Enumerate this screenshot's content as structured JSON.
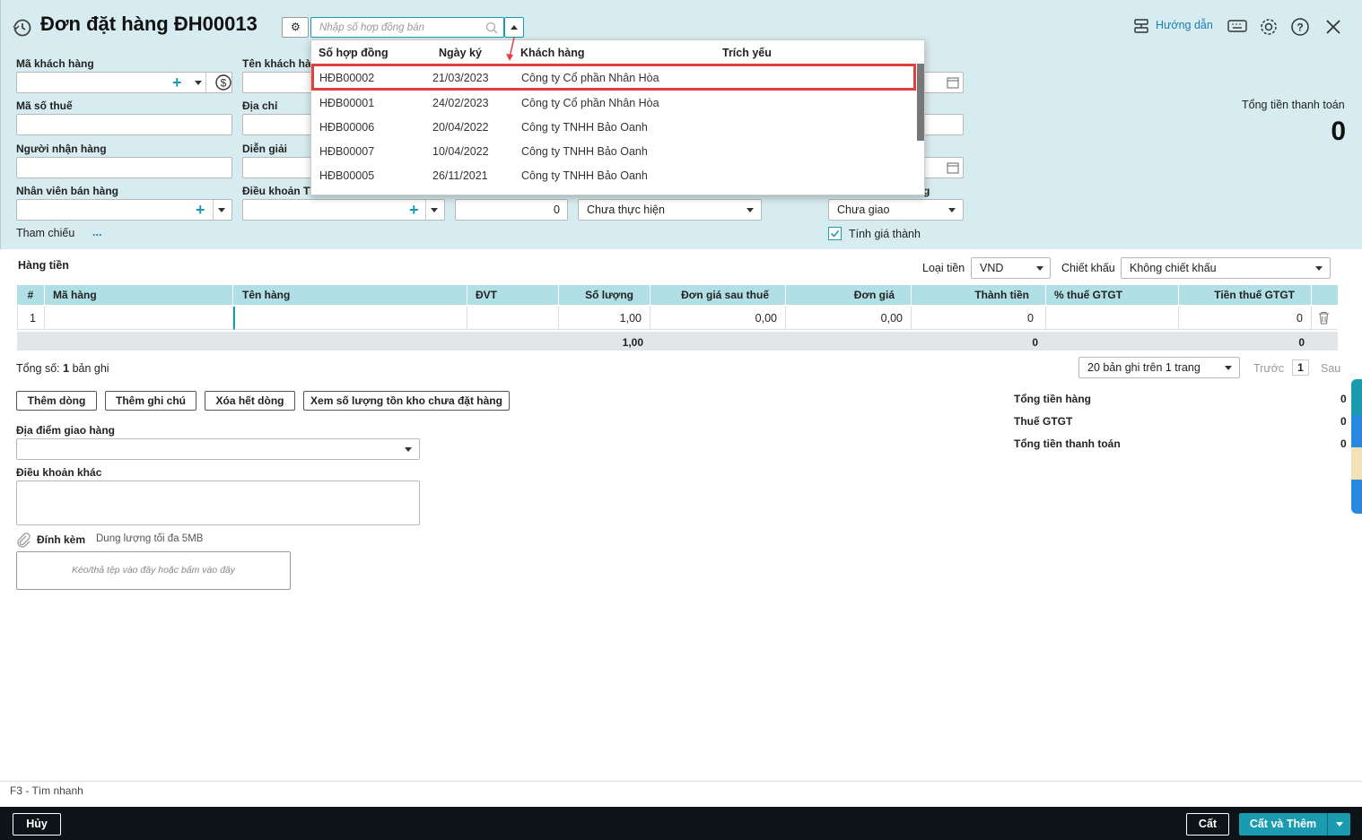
{
  "header": {
    "title": "Đơn đặt hàng ĐH00013",
    "search_placeholder": "Nhập số hợp đồng bán",
    "help_label": "Hướng dẫn",
    "total_label": "Tổng tiền thanh toán",
    "total_value": "0"
  },
  "form": {
    "ma_khach_hang": "Mã khách hàng",
    "ten_khach_hang": "Tên khách hàn",
    "ma_so_thue": "Mã số thuế",
    "dia_chi": "Địa chỉ",
    "nguoi_nhan_hang": "Người nhận hàng",
    "dien_giai": "Diễn giải",
    "nhan_vien_ban_hang": "Nhân viên bán hàng",
    "dieu_khoan_tt": "Điều khoản TT",
    "so_ngay_value": "0",
    "tinh_trang_value": "Chưa thực hiện",
    "giao_hang_label_partial": "g",
    "giao_hang_value": "Chưa giao",
    "tinh_gia_thanh": "Tính giá thành",
    "tham_chieu": "Tham chiếu",
    "tham_chieu_more": "..."
  },
  "dropdown": {
    "columns": [
      "Số hợp đồng",
      "Ngày ký",
      "Khách hàng",
      "Trích yếu"
    ],
    "rows": [
      {
        "so": "HĐB00002",
        "ngay": "21/03/2023",
        "kh": "Công ty Cổ phần Nhân Hòa",
        "selected": true
      },
      {
        "so": "HĐB00001",
        "ngay": "24/02/2023",
        "kh": "Công ty Cổ phần Nhân Hòa",
        "selected": false
      },
      {
        "so": "HĐB00006",
        "ngay": "20/04/2022",
        "kh": "Công ty TNHH Bảo Oanh",
        "selected": false
      },
      {
        "so": "HĐB00007",
        "ngay": "10/04/2022",
        "kh": "Công ty TNHH Bảo Oanh",
        "selected": false
      },
      {
        "so": "HĐB00005",
        "ngay": "26/11/2021",
        "kh": "Công ty TNHH Bảo Oanh",
        "selected": false
      }
    ]
  },
  "goods": {
    "section_title": "Hàng tiền",
    "currency_label": "Loại tiền",
    "currency_value": "VND",
    "discount_label": "Chiết khấu",
    "discount_value": "Không chiết khấu",
    "columns": [
      "#",
      "Mã hàng",
      "Tên hàng",
      "ĐVT",
      "Số lượng",
      "Đơn giá sau thuế",
      "Đơn giá",
      "Thành tiền",
      "% thuế GTGT",
      "Tiền thuế GTGT"
    ],
    "row": {
      "stt": "1",
      "so_luong": "1,00",
      "don_gia_sau_thue": "0,00",
      "don_gia": "0,00",
      "thanh_tien": "0",
      "tien_thue": "0"
    },
    "totals": {
      "so_luong": "1,00",
      "thanh_tien": "0",
      "tien_thue": "0"
    },
    "record_prefix": "Tổng số:",
    "record_count": "1",
    "record_suffix": "bản ghi",
    "page_size": "20 bản ghi trên 1 trang",
    "prev": "Trước",
    "page": "1",
    "next": "Sau"
  },
  "buttons": {
    "them_dong": "Thêm dòng",
    "them_ghi_chu": "Thêm ghi chú",
    "xoa_het_dong": "Xóa hết dòng",
    "xem_ton_kho": "Xem số lượng tồn kho chưa đặt hàng"
  },
  "summary": {
    "tong_tien_hang": "Tổng tiền hàng",
    "tong_tien_hang_value": "0",
    "thue_gtgt": "Thuế GTGT",
    "thue_gtgt_value": "0",
    "tong_thanh_toan": "Tổng tiền thanh toán",
    "tong_thanh_toan_value": "0"
  },
  "extra": {
    "dia_diem": "Địa điểm giao hàng",
    "dieu_khoan_khac": "Điều khoản khác",
    "dinh_kem": "Đính kèm",
    "dung_luong": "Dung lượng tối đa 5MB",
    "drop_hint": "Kéo/thả tệp vào đây hoặc bấm vào đây"
  },
  "statusbar": {
    "hint": "F3 - Tìm nhanh"
  },
  "footer": {
    "cancel": "Hủy",
    "save": "Cất",
    "save_add": "Cất và Thêm"
  },
  "colors": {
    "accent": "#1a9bb0",
    "header_bg": "#d7ecf0",
    "table_header": "#b0e0e6",
    "selection_border": "#e04040",
    "footer_bg": "#0c1418"
  }
}
